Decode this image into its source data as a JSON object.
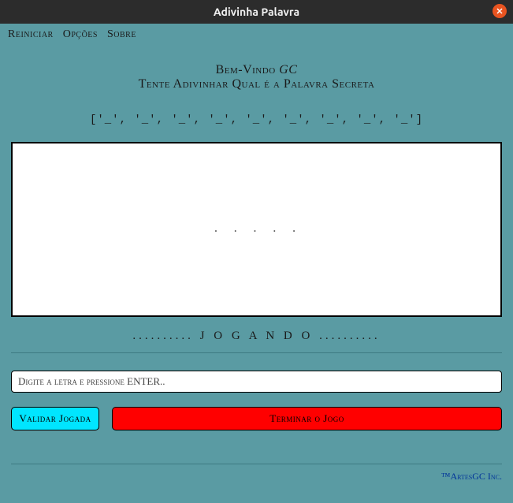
{
  "window": {
    "title": "Adivinha Palavra"
  },
  "menu": {
    "restart": "Reiniciar",
    "options": "Opções",
    "about": "Sobre"
  },
  "welcome": {
    "prefix": "Bem-Vindo ",
    "username": "GC",
    "subtitle": "Tente Adivinhar Qual é a Palavra Secreta"
  },
  "hidden_word": "['_', '_', '_', '_', '_', '_', '_', '_', '_']",
  "game_area_content": ". . . . .",
  "status": ".......... J O G A N D O ..........",
  "input": {
    "placeholder": "Digite a letra e pressione ENTER.."
  },
  "buttons": {
    "validate": "Validar Jogada",
    "end_game": "Terminar o Jogo"
  },
  "footer": "™ArtesGC Inc."
}
